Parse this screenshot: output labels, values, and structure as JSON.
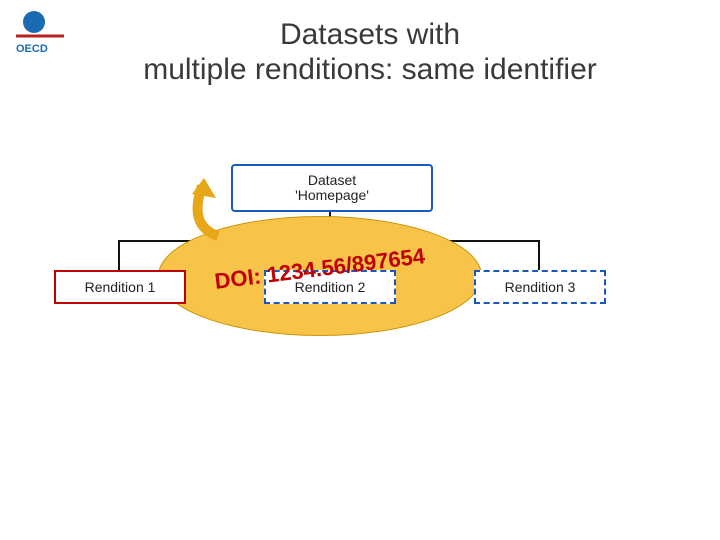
{
  "title": "Datasets with\nmultiple renditions: same identifier",
  "homepage": "Dataset\n'Homepage'",
  "renditions": {
    "r1": "Rendition 1",
    "r2": "Rendition 2",
    "r3": "Rendition 3"
  },
  "doi": "DOI: 1234.56/897654",
  "logo_label": "OECD"
}
